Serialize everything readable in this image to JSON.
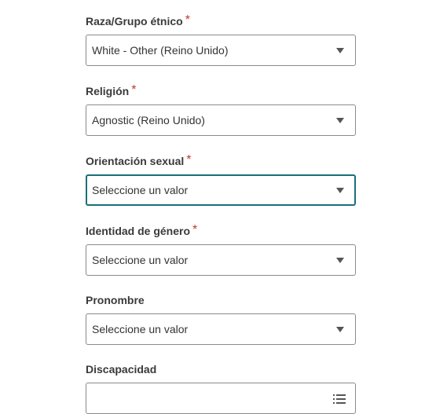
{
  "form": {
    "fields": [
      {
        "label": "Raza/Grupo étnico",
        "required_mark": "*",
        "value": "White - Other (Reino Unido)"
      },
      {
        "label": "Religión",
        "required_mark": "*",
        "value": "Agnostic (Reino Unido)"
      },
      {
        "label": "Orientación sexual",
        "required_mark": "*",
        "value": "Seleccione un valor"
      },
      {
        "label": "Identidad de género",
        "required_mark": "*",
        "value": "Seleccione un valor"
      },
      {
        "label": "Pronombre",
        "value": "Seleccione un valor"
      },
      {
        "label": "Discapacidad",
        "value": ""
      }
    ]
  },
  "colors": {
    "required": "#c0392b",
    "focus_border": "#1b6f7a",
    "border": "#8a8a8a"
  },
  "icons": {
    "dropdown": "caret-down-icon",
    "multiselect": "list-icon"
  }
}
